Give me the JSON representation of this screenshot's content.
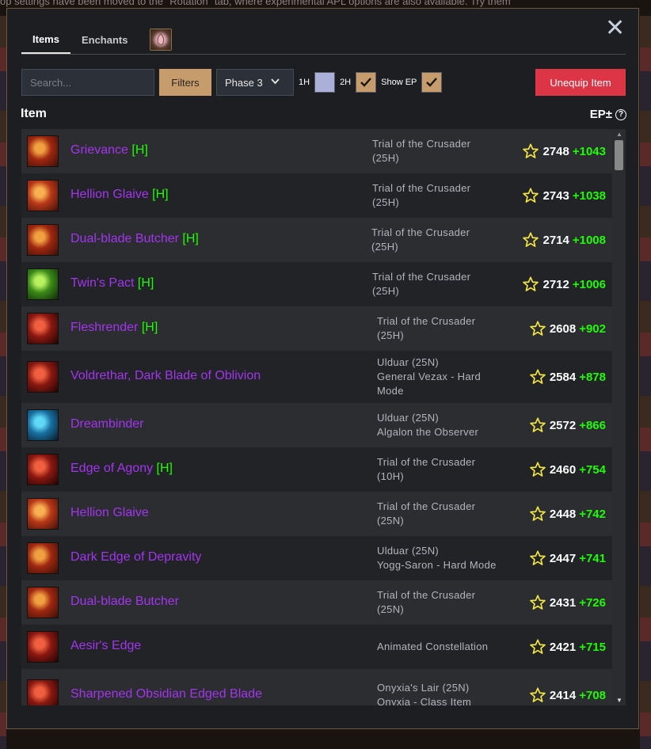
{
  "background_hint": "op settings have been moved to the \"Rotation\" tab, where experimental APL options are also available. Try them",
  "tabs": [
    {
      "label": "Items",
      "active": true
    },
    {
      "label": "Enchants",
      "active": false
    }
  ],
  "toolbar": {
    "search_placeholder": "Search...",
    "filters_label": "Filters",
    "phase_label": "Phase 3",
    "one_hand_label": "1H",
    "two_hand_label": "2H",
    "show_ep_label": "Show EP",
    "unequip_label": "Unequip Item"
  },
  "header": {
    "item": "Item",
    "ep": "EP±",
    "help": "?"
  },
  "colors": {
    "epic": "#a335ee",
    "heroic": "#1eff00",
    "accent": "#c69c6d",
    "danger": "#dc3545"
  },
  "items": [
    {
      "name": "Grievance",
      "heroic": "[H]",
      "source": [
        "Trial of the Crusader",
        "(25H)"
      ],
      "ep": "2748",
      "delta": "+1043",
      "icon": "axe-icon"
    },
    {
      "name": "Hellion Glaive",
      "heroic": "[H]",
      "source": [
        "Trial of the Crusader",
        "(25H)"
      ],
      "ep": "2743",
      "delta": "+1038",
      "icon": "polearm-icon"
    },
    {
      "name": "Dual-blade Butcher",
      "heroic": "[H]",
      "source": [
        "Trial of the Crusader",
        "(25H)"
      ],
      "ep": "2714",
      "delta": "+1008",
      "icon": "axe-icon"
    },
    {
      "name": "Twin's Pact",
      "heroic": "[H]",
      "source": [
        "Trial of the Crusader",
        "(25H)"
      ],
      "ep": "2712",
      "delta": "+1006",
      "icon": "blade-icon"
    },
    {
      "name": "Fleshrender",
      "heroic": "[H]",
      "source": [
        "Trial of the Crusader",
        "(25H)"
      ],
      "ep": "2608",
      "delta": "+902",
      "icon": "sword-icon"
    },
    {
      "name": "Voldrethar, Dark Blade of Oblivion",
      "heroic": "",
      "source": [
        "Ulduar (25N)",
        "General Vezax - Hard",
        "Mode"
      ],
      "ep": "2584",
      "delta": "+878",
      "icon": "sword-icon"
    },
    {
      "name": "Dreambinder",
      "heroic": "",
      "source": [
        "Ulduar (25N)",
        "Algalon the Observer"
      ],
      "ep": "2572",
      "delta": "+866",
      "icon": "staff-icon"
    },
    {
      "name": "Edge of Agony",
      "heroic": "[H]",
      "source": [
        "Trial of the Crusader",
        "(10H)"
      ],
      "ep": "2460",
      "delta": "+754",
      "icon": "sword-icon"
    },
    {
      "name": "Hellion Glaive",
      "heroic": "",
      "source": [
        "Trial of the Crusader",
        "(25N)"
      ],
      "ep": "2448",
      "delta": "+742",
      "icon": "polearm-icon"
    },
    {
      "name": "Dark Edge of Depravity",
      "heroic": "",
      "source": [
        "Ulduar (25N)",
        "Yogg-Saron - Hard Mode"
      ],
      "ep": "2447",
      "delta": "+741",
      "icon": "axe-icon"
    },
    {
      "name": "Dual-blade Butcher",
      "heroic": "",
      "source": [
        "Trial of the Crusader",
        "(25N)"
      ],
      "ep": "2431",
      "delta": "+726",
      "icon": "axe-icon"
    },
    {
      "name": "Aesir's Edge",
      "heroic": "",
      "source": [
        "Animated Constellation"
      ],
      "ep": "2421",
      "delta": "+715",
      "icon": "sword-icon"
    },
    {
      "name": "Sharpened Obsidian Edged Blade",
      "heroic": "",
      "source": [
        "Onyxia's Lair (25N)",
        "Onyxia - Class Item"
      ],
      "ep": "2414",
      "delta": "+708",
      "icon": "sword-icon"
    }
  ]
}
